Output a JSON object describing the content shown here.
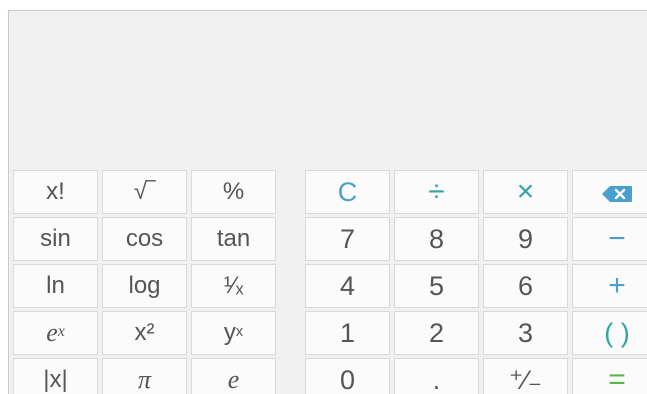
{
  "display": {
    "value": ""
  },
  "keys": {
    "row1": [
      "x!",
      "√‾",
      "%",
      "C",
      "÷",
      "×"
    ],
    "row2": [
      "sin",
      "cos",
      "tan",
      "7",
      "8",
      "9",
      "−"
    ],
    "row3": [
      "ln",
      "log",
      "¹⁄ₓ",
      "4",
      "5",
      "6",
      "+"
    ],
    "row4": [
      "e",
      "x²",
      "y",
      "1",
      "2",
      "3",
      "( )"
    ],
    "row5": [
      "|x|",
      "π",
      "e",
      "0",
      ".",
      "⁺⁄₋",
      "="
    ]
  },
  "superscripts": {
    "ex": "x",
    "yx": "x"
  },
  "icons": {
    "backspace": "backspace-icon"
  },
  "colors": {
    "clear": "#4a9fd0",
    "operator_divide": "#2fa6a0",
    "operator_multiply": "#2fa6a0",
    "operator_minus": "#4a9fd0",
    "operator_plus": "#4a9fd0",
    "parentheses": "#2fa6a0",
    "equals": "#59b84b",
    "backspace": "#4a9fd0"
  }
}
